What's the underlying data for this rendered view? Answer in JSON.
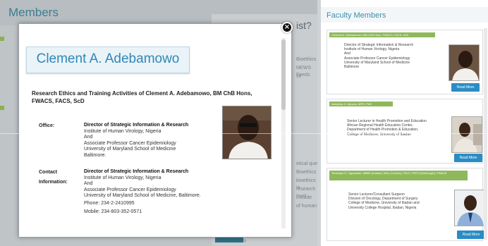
{
  "background": {
    "page_title": "Members",
    "heading_fragment": "ist?",
    "snippets": [
      "Bioethics",
      "NEWS Feeds",
      "se",
      "etical que",
      "Bioethics",
      "bioethics in",
      "research invol",
      "include",
      "of human",
      "health"
    ]
  },
  "modal": {
    "name": "Clement A. Adebamowo",
    "research_title": "Research Ethics and Training Activities of Clement A. Adebamowo, BM ChB Hons, FWACS, FACS, ScD",
    "office": {
      "label": "Office:",
      "lines": [
        "Director of Strategic Information & Research",
        "Institute of Human Virology, Nigeria",
        "And",
        "Associate Professor Cancer Epidemiology",
        "University of Maryland School of Medicine",
        "Baltimore."
      ]
    },
    "contact": {
      "label_line1": "Contact",
      "label_line2": "Information:",
      "lines": [
        "Director of Strategic Information & Research",
        "Institute of Human Virology, Nigeria",
        "And",
        "Associate Professor Cancer Epidemiology",
        "University of Maryland School of Medicine, Baltimore."
      ],
      "phone": "Phone:  234-2-2410995",
      "mobile": "Mobile:  234-803-352-0571"
    },
    "close_label": "×"
  },
  "faculty": {
    "title": "Faculty Members",
    "cards": [
      {
        "tag": "Clement A. Adebamowo, BM ChB Hons, FWACS, FACS, ScD",
        "lines": [
          "Director of Strategic Information & Research",
          "Institute of Human Virology, Nigeria",
          "And",
          "Associate Professor Cancer Epidemiology",
          "University of Maryland School of Medicine",
          "Baltimore"
        ],
        "button": "Read More"
      },
      {
        "tag": "Adeyinka G. Ajuwon, MPH, PhD",
        "lines": [
          "Senior Lecturer in Health Promotion and Education",
          "African Regional Health Education Center,",
          "Department of Health Promotion & Education,",
          "College of Medicine, University of Ibadan"
        ],
        "button": "Read More"
      },
      {
        "tag": "Temidayo O. Ogundiran, MBBS (Ibadan), MSc (Toronto), FACS, FRCS (Edinburgh), FWACS",
        "lines": [
          "Senior Lecturer/Consultant Surgeon",
          "Division of Oncology, Department of Surgery",
          "College of Medicine, University of Ibadan and",
          "University College Hospital, Ibadan, Nigeria"
        ],
        "button": "Read More"
      }
    ]
  },
  "colors": {
    "accent_blue": "#2f87b8",
    "tag_green": "#8fb85c",
    "button_blue": "#2a8cc4"
  }
}
